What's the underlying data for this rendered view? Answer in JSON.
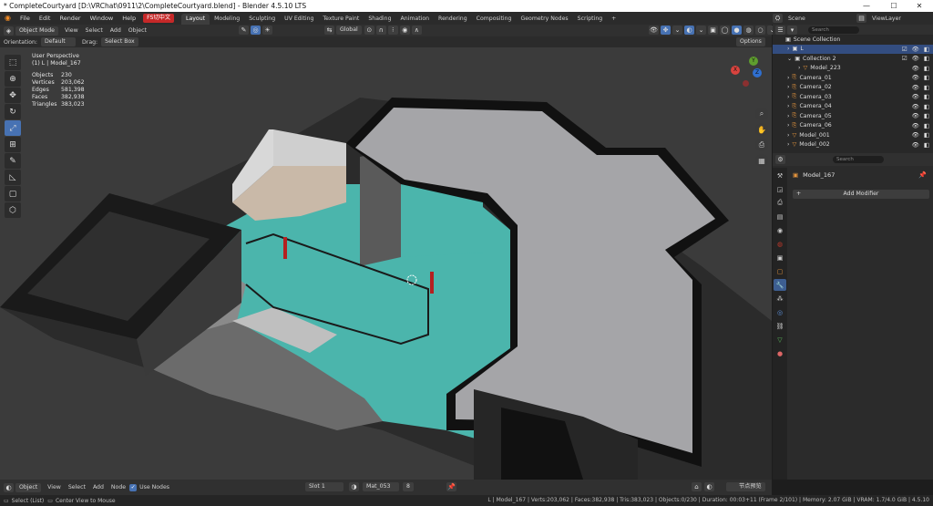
{
  "window": {
    "title": "* CompleteCourtyard [D:\\VRChat\\0911\\2\\CompleteCourtyard.blend] - Blender 4.5.10 LTS",
    "controls": [
      "—",
      "☐",
      "✕"
    ]
  },
  "menubar": {
    "items": [
      "File",
      "Edit",
      "Render",
      "Window",
      "Help"
    ],
    "lang_badge": "FS切中文",
    "workspaces": [
      "Layout",
      "Modeling",
      "Sculpting",
      "UV Editing",
      "Texture Paint",
      "Shading",
      "Animation",
      "Rendering",
      "Compositing",
      "Geometry Nodes",
      "Scripting"
    ],
    "add_tab": "+",
    "scene": "Scene",
    "view_layer": "ViewLayer"
  },
  "viewport_header": {
    "mode": "Object Mode",
    "menus": [
      "View",
      "Select",
      "Add",
      "Object"
    ],
    "transform": "Global",
    "options": "Options"
  },
  "tool_settings": {
    "orientation_label": "Orientation:",
    "orientation_value": "Default",
    "drag_label": "Drag:",
    "drag_value": "Select Box"
  },
  "overlay": {
    "perspective": "User Perspective",
    "object": "(1) L | Model_167",
    "stats": [
      {
        "k": "Objects",
        "v": "230"
      },
      {
        "k": "Vertices",
        "v": "203,062"
      },
      {
        "k": "Edges",
        "v": "581,398"
      },
      {
        "k": "Faces",
        "v": "382,938"
      },
      {
        "k": "Triangles",
        "v": "383,023"
      }
    ]
  },
  "gizmo": {
    "x": "X",
    "y": "Y",
    "z": "Z"
  },
  "outliner": {
    "search_placeholder": "Search",
    "root": "Scene Collection",
    "rows": [
      {
        "label": "L",
        "selected": true
      },
      {
        "label": "Collection 2"
      },
      {
        "label": "Model_223"
      },
      {
        "label": "Camera_01"
      },
      {
        "label": "Camera_02"
      },
      {
        "label": "Camera_03"
      },
      {
        "label": "Camera_04"
      },
      {
        "label": "Camera_05"
      },
      {
        "label": "Camera_06"
      },
      {
        "label": "Model_001"
      },
      {
        "label": "Model_002"
      }
    ]
  },
  "properties": {
    "search_placeholder": "Search",
    "object_name": "Model_167",
    "add_modifier": "Add Modifier"
  },
  "bottom_header": {
    "editor": "Object",
    "menus": [
      "View",
      "Select",
      "Add",
      "Node"
    ],
    "use_nodes": "Use Nodes",
    "slot": "Slot 1",
    "material": "Mat_053",
    "users": "8",
    "node_label": "节点预览"
  },
  "statusbar": {
    "left1": "Select (List)",
    "left2": "Center View to Mouse",
    "right": "L | Model_167 | Verts:203,062 | Faces:382,938 | Tris:383,023 | Objects:0/230 | Duration: 00:03+11 (Frame 2/101) | Memory: 2.07 GiB | VRAM: 1.7/4.0 GiB | 4.5.10"
  }
}
